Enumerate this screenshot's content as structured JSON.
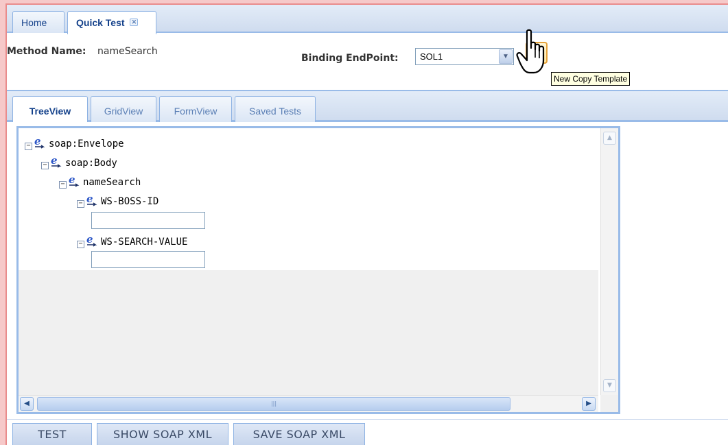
{
  "tabs": [
    {
      "label": "Home",
      "active": false
    },
    {
      "label": "Quick Test",
      "active": true,
      "closable": true
    }
  ],
  "method": {
    "name_label": "Method Name:",
    "name_value": "nameSearch",
    "binding_label": "Binding EndPoint:",
    "binding_value": "SOL1",
    "copy_icon": "copy-template-icon",
    "tooltip": "New Copy Template"
  },
  "view_tabs": [
    {
      "label": "TreeView",
      "active": true
    },
    {
      "label": "GridView",
      "active": false
    },
    {
      "label": "FormView",
      "active": false
    },
    {
      "label": "Saved Tests",
      "active": false
    }
  ],
  "tree": [
    {
      "label": "soap:Envelope",
      "level": 0,
      "has_input": false,
      "value": ""
    },
    {
      "label": "soap:Body",
      "level": 1,
      "has_input": false,
      "value": ""
    },
    {
      "label": "nameSearch",
      "level": 2,
      "has_input": false,
      "value": ""
    },
    {
      "label": "WS-BOSS-ID",
      "level": 3,
      "has_input": true,
      "value": ""
    },
    {
      "label": "WS-SEARCH-VALUE",
      "level": 3,
      "has_input": true,
      "value": ""
    }
  ],
  "buttons": {
    "test": "TEST",
    "show_soap": "SHOW SOAP XML",
    "save_soap": "SAVE SOAP XML"
  },
  "colors": {
    "frame": "#e98c8c",
    "tab_border": "#8db2e3",
    "text_primary": "#15428b"
  }
}
